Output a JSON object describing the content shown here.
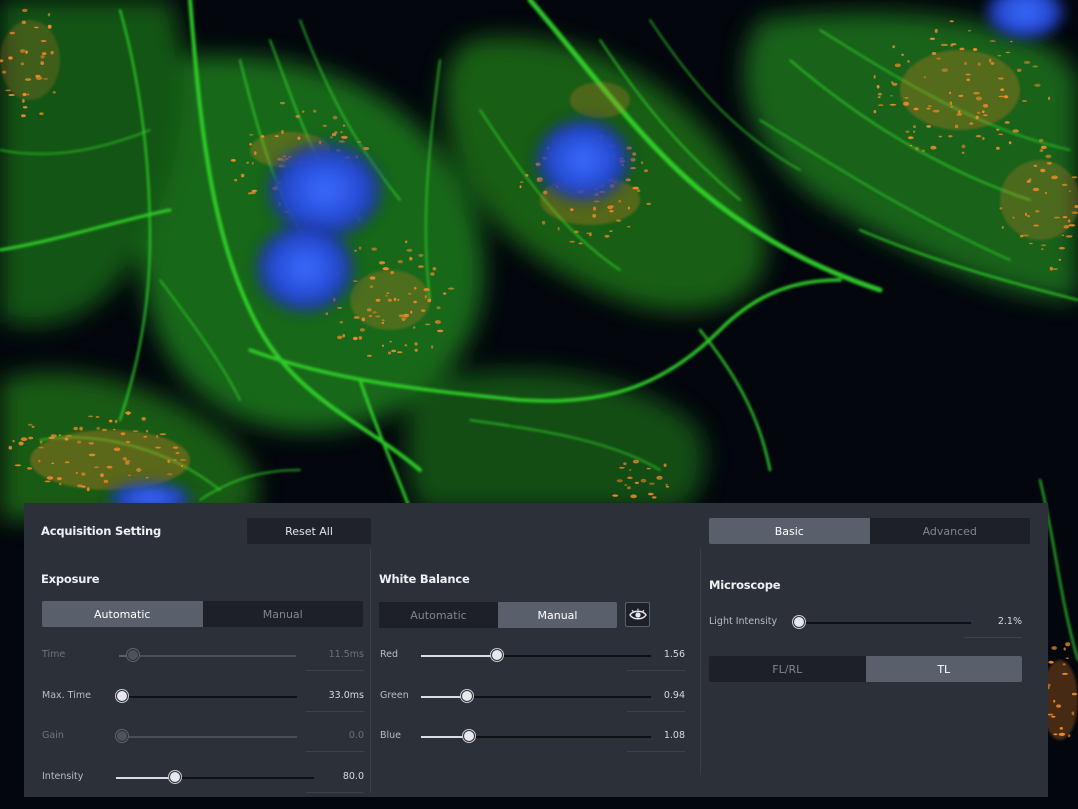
{
  "panel": {
    "title": "Acquisition Setting",
    "reset_label": "Reset All",
    "view_tabs": [
      {
        "label": "Basic",
        "active": true
      },
      {
        "label": "Advanced",
        "active": false
      }
    ]
  },
  "exposure": {
    "title": "Exposure",
    "modes": [
      {
        "label": "Automatic",
        "active": true
      },
      {
        "label": "Manual",
        "active": false
      }
    ],
    "rows": [
      {
        "label": "Time",
        "value": "11.5ms",
        "fraction": 0.08,
        "enabled": false
      },
      {
        "label": "Max. Time",
        "value": "33.0ms",
        "fraction": 0.0,
        "enabled": true
      },
      {
        "label": "Gain",
        "value": "0.0",
        "fraction": 0.0,
        "enabled": false
      },
      {
        "label": "Intensity",
        "value": "80.0",
        "fraction": 0.3,
        "enabled": true
      }
    ]
  },
  "white_balance": {
    "title": "White Balance",
    "modes": [
      {
        "label": "Automatic",
        "active": false
      },
      {
        "label": "Manual",
        "active": true
      }
    ],
    "eye_icon": "eye-icon",
    "rows": [
      {
        "label": "Red",
        "value": "1.56",
        "fraction": 0.33,
        "enabled": true
      },
      {
        "label": "Green",
        "value": "0.94",
        "fraction": 0.2,
        "enabled": true
      },
      {
        "label": "Blue",
        "value": "1.08",
        "fraction": 0.21,
        "enabled": true
      }
    ]
  },
  "microscope": {
    "title": "Microscope",
    "light": {
      "label": "Light Intensity",
      "value": "2.1%",
      "fraction": 0.02,
      "enabled": true
    },
    "modes": [
      {
        "label": "FL/RL",
        "active": false
      },
      {
        "label": "TL",
        "active": true
      }
    ]
  },
  "colors": {
    "panel_bg": "#2c3038",
    "active_segment": "#59606b",
    "segment_bg": "#1d2026",
    "nucleus_stain": "#2a4fd6",
    "actin_stain": "#2fd12a",
    "mitochondria_stain": "#e8842a"
  }
}
